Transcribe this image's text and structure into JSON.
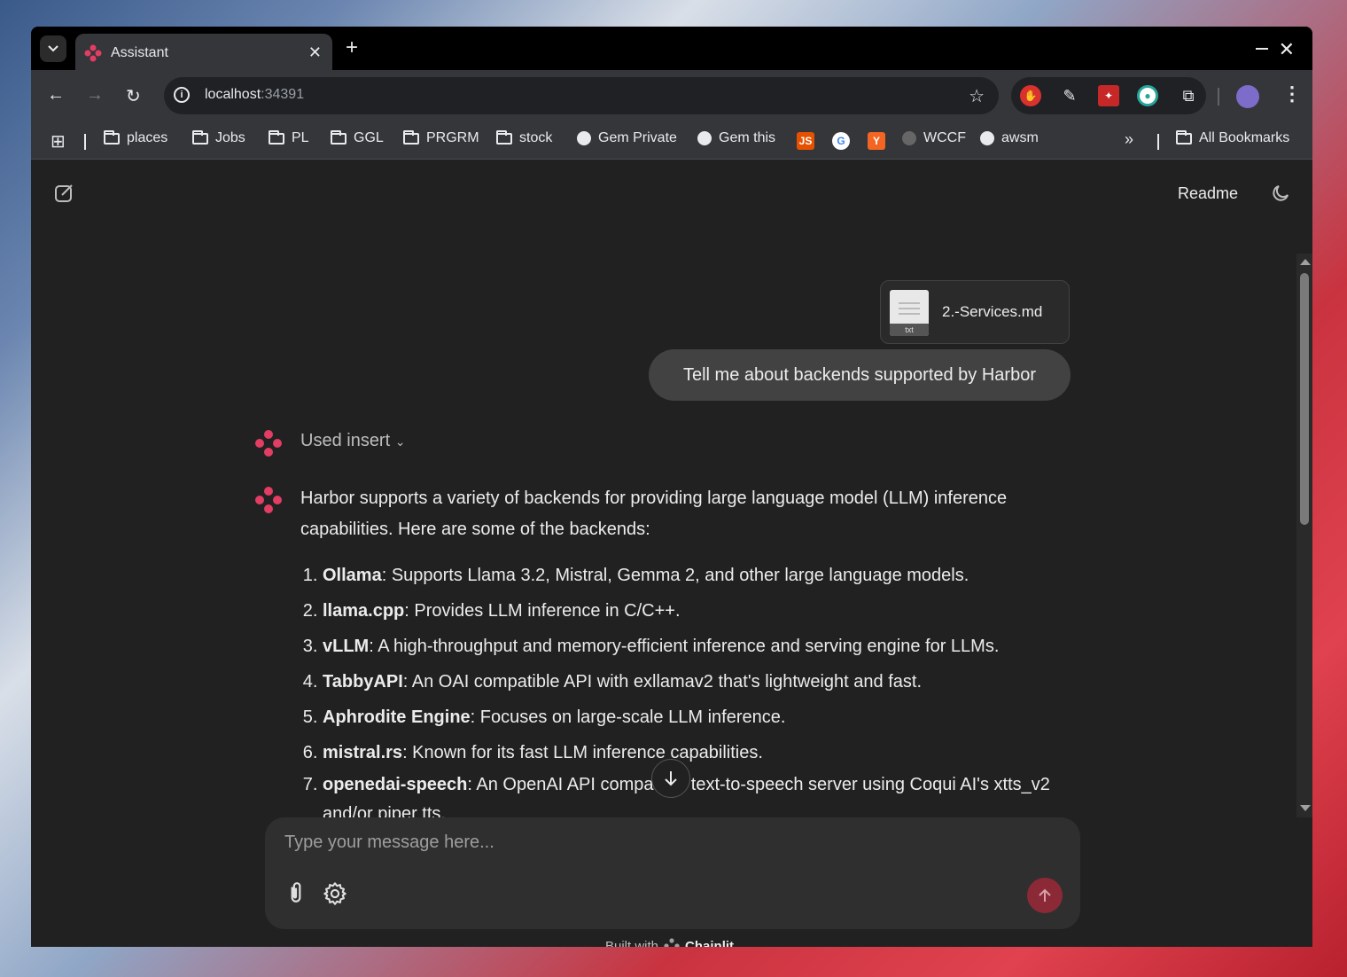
{
  "browser": {
    "tab_title": "Assistant",
    "url_host": "localhost",
    "url_port": ":34391",
    "bookmarks": [
      {
        "label": "places",
        "icon": "folder-icon"
      },
      {
        "label": "Jobs",
        "icon": "folder-icon"
      },
      {
        "label": "PL",
        "icon": "folder-icon"
      },
      {
        "label": "GGL",
        "icon": "folder-icon"
      },
      {
        "label": "PRGRM",
        "icon": "folder-icon"
      },
      {
        "label": "stock",
        "icon": "folder-icon"
      },
      {
        "label": "Gem Private",
        "icon": "globe-icon"
      },
      {
        "label": "Gem this",
        "icon": "globe-icon"
      },
      {
        "label": "WCCF",
        "icon": "site-icon"
      },
      {
        "label": "awsm",
        "icon": "github-icon"
      }
    ],
    "all_bookmarks": "All Bookmarks",
    "overflow": "»"
  },
  "app": {
    "readme_label": "Readme",
    "attachment": {
      "name": "2.-Services.md",
      "ext": "txt"
    },
    "user_message": "Tell me about backends supported by Harbor",
    "tool_step": "Used insert",
    "assistant_intro": "Harbor supports a variety of backends for providing large language model (LLM) inference capabilities. Here are some of the backends:",
    "backends": [
      {
        "name": "Ollama",
        "desc": ": Supports Llama 3.2, Mistral, Gemma 2, and other large language models."
      },
      {
        "name": "llama.cpp",
        "desc": ": Provides LLM inference in C/C++."
      },
      {
        "name": "vLLM",
        "desc": ": A high-throughput and memory-efficient inference and serving engine for LLMs."
      },
      {
        "name": "TabbyAPI",
        "desc": ": An OAI compatible API with exllamav2 that's lightweight and fast."
      },
      {
        "name": "Aphrodite Engine",
        "desc": ": Focuses on large-scale LLM inference."
      },
      {
        "name": "mistral.rs",
        "desc": ": Known for its fast LLM inference capabilities."
      },
      {
        "name": "openedai-speech",
        "desc": ": An OpenAI API compatible text-to-speech server using Coqui AI's xtts_v2 and/or piper tts."
      }
    ],
    "composer_placeholder": "Type your message here...",
    "footer_prefix": "Built with",
    "footer_brand": "Chainlit"
  },
  "colors": {
    "accent": "#e23d63",
    "send_bg": "#8b2a36"
  }
}
